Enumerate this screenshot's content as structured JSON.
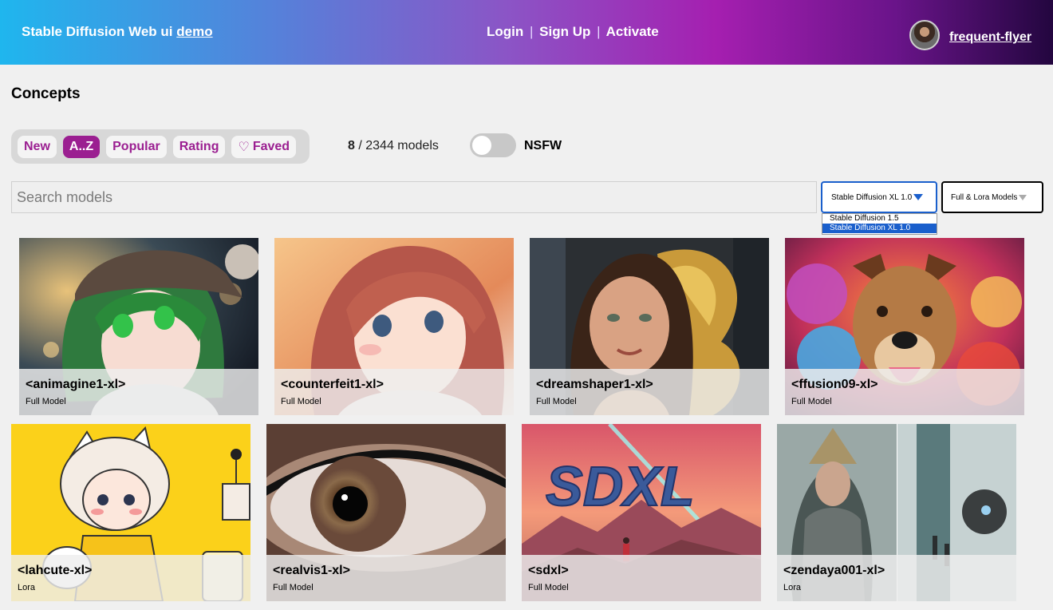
{
  "header": {
    "brand": "Stable Diffusion Web ui",
    "brand_link": "demo",
    "nav": {
      "login": "Login",
      "signup": "Sign Up",
      "activate": "Activate",
      "separator": "|"
    },
    "username": "frequent-flyer"
  },
  "page_title": "Concepts",
  "filters": {
    "new": "New",
    "az": "A..Z",
    "popular": "Popular",
    "rating": "Rating",
    "faved": "Faved"
  },
  "count": {
    "shown": "8",
    "rest": "/ 2344 models"
  },
  "nsfw": {
    "label": "NSFW",
    "enabled": false
  },
  "search": {
    "placeholder": "Search models",
    "value": ""
  },
  "base_select": {
    "value": "Stable Diffusion XL 1.0",
    "options": [
      "Stable Diffusion 1.5",
      "Stable Diffusion XL 1.0"
    ]
  },
  "type_select": {
    "value": "Full & Lora Models"
  },
  "cards": [
    {
      "name": "<animagine1-xl>",
      "type": "Full Model"
    },
    {
      "name": "<counterfeit1-xl>",
      "type": "Full Model"
    },
    {
      "name": "<dreamshaper1-xl>",
      "type": "Full Model"
    },
    {
      "name": "<ffusion09-xl>",
      "type": "Full Model"
    },
    {
      "name": "<lahcute-xl>",
      "type": "Lora"
    },
    {
      "name": "<realvis1-xl>",
      "type": "Full Model"
    },
    {
      "name": "<sdxl>",
      "type": "Full Model"
    },
    {
      "name": "<zendaya001-xl>",
      "type": "Lora"
    }
  ],
  "colors": {
    "accent": "#9b1f91",
    "select_blue": "#1a5fcc"
  }
}
